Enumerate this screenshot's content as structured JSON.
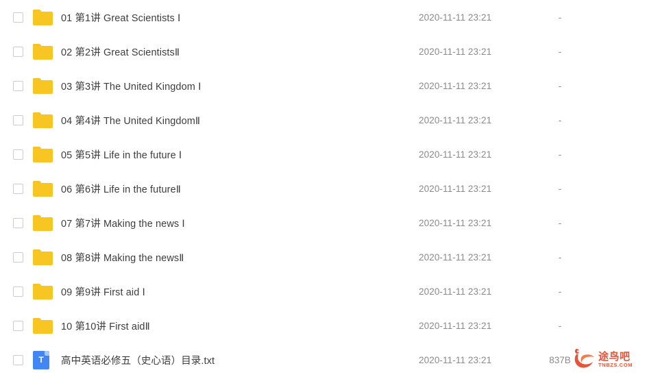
{
  "colors": {
    "folder": "#f7c623",
    "txt_icon": "#4285f4",
    "name_text": "#3d3d3d",
    "meta_text": "#8a8a8a",
    "watermark": "#e8543a",
    "background": "#ffffff",
    "checkbox_border": "#c9ccd1"
  },
  "columns": {
    "select": "",
    "name": "",
    "modified": "",
    "size": ""
  },
  "rows": [
    {
      "icon": "folder-icon",
      "type": "folder",
      "name": "01 第1讲 Great Scientists Ⅰ",
      "modified": "2020-11-11 23:21",
      "size": "-",
      "checked": false
    },
    {
      "icon": "folder-icon",
      "type": "folder",
      "name": "02 第2讲 Great ScientistsⅡ",
      "modified": "2020-11-11 23:21",
      "size": "-",
      "checked": false
    },
    {
      "icon": "folder-icon",
      "type": "folder",
      "name": "03 第3讲 The United Kingdom Ⅰ",
      "modified": "2020-11-11 23:21",
      "size": "-",
      "checked": false
    },
    {
      "icon": "folder-icon",
      "type": "folder",
      "name": "04 第4讲 The United KingdomⅡ",
      "modified": "2020-11-11 23:21",
      "size": "-",
      "checked": false
    },
    {
      "icon": "folder-icon",
      "type": "folder",
      "name": "05 第5讲 Life in the future Ⅰ",
      "modified": "2020-11-11 23:21",
      "size": "-",
      "checked": false
    },
    {
      "icon": "folder-icon",
      "type": "folder",
      "name": "06 第6讲 Life in the futureⅡ",
      "modified": "2020-11-11 23:21",
      "size": "-",
      "checked": false
    },
    {
      "icon": "folder-icon",
      "type": "folder",
      "name": "07 第7讲 Making the news Ⅰ",
      "modified": "2020-11-11 23:21",
      "size": "-",
      "checked": false
    },
    {
      "icon": "folder-icon",
      "type": "folder",
      "name": "08 第8讲 Making the newsⅡ",
      "modified": "2020-11-11 23:21",
      "size": "-",
      "checked": false
    },
    {
      "icon": "folder-icon",
      "type": "folder",
      "name": "09 第9讲 First aid Ⅰ",
      "modified": "2020-11-11 23:21",
      "size": "-",
      "checked": false
    },
    {
      "icon": "folder-icon",
      "type": "folder",
      "name": "10 第10讲  First aidⅡ",
      "modified": "2020-11-11 23:21",
      "size": "-",
      "checked": false
    },
    {
      "icon": "text-file-icon",
      "type": "file",
      "glyph": "T",
      "name": "高中英语必修五（史心语）目录.txt",
      "modified": "2020-11-11 23:21",
      "size": "837B",
      "checked": false
    }
  ],
  "watermark": {
    "logo": "phoenix-logo-icon",
    "cn": "途鸟吧",
    "en": "TNBZS.COM"
  }
}
